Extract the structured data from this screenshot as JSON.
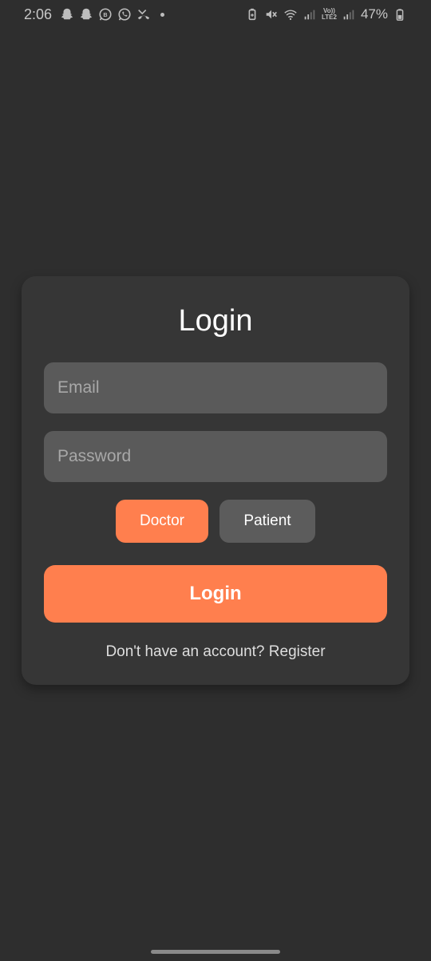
{
  "status_bar": {
    "time": "2:06",
    "left_icons": [
      "snapchat-icon",
      "snapchat-icon",
      "whatsapp-business-icon",
      "whatsapp-icon",
      "missed-call-icon"
    ],
    "right_icons": [
      "battery-saver-icon",
      "mute-icon",
      "wifi-icon",
      "signal-icon",
      "volte-icon",
      "signal-icon",
      "battery-icon"
    ],
    "volte_line1": "Vo))",
    "volte_line2": "LTE2",
    "battery_percent": "47%"
  },
  "login_card": {
    "title": "Login",
    "email_placeholder": "Email",
    "password_placeholder": "Password",
    "role_doctor_label": "Doctor",
    "role_patient_label": "Patient",
    "selected_role": "Doctor",
    "login_button_label": "Login",
    "register_text": "Don't have an account? Register"
  },
  "colors": {
    "background": "#2e2e2e",
    "card": "#363636",
    "accent": "#ff7f4e",
    "input": "#5a5a5a",
    "unselected_role": "#5c5c5c"
  }
}
